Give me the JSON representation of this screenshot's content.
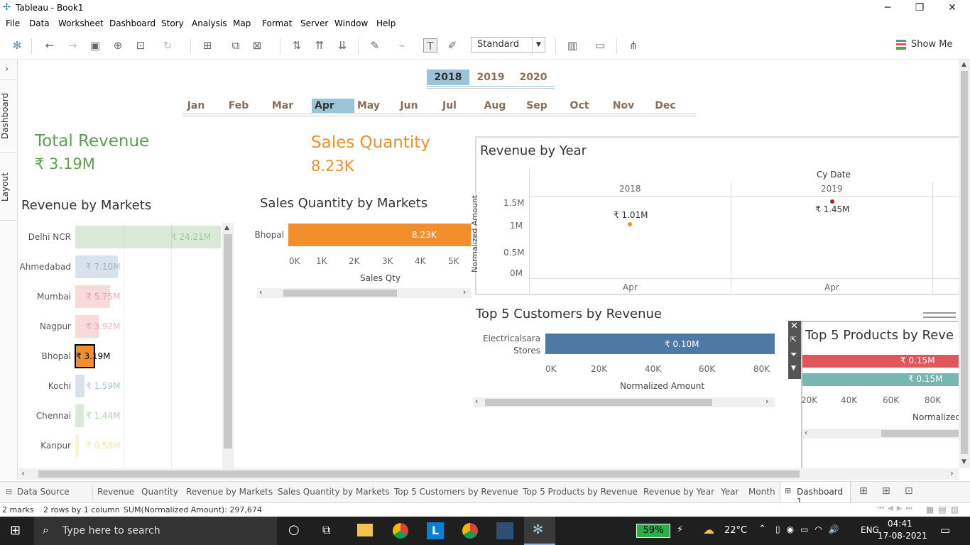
{
  "app": {
    "title": "Tableau - Book1"
  },
  "menu": [
    "File",
    "Data",
    "Worksheet",
    "Dashboard",
    "Story",
    "Analysis",
    "Map",
    "Format",
    "Server",
    "Window",
    "Help"
  ],
  "toolbar": {
    "mode": "Standard",
    "show_me": "Show Me"
  },
  "side_tabs": {
    "dashboard": "Dashboard",
    "layout": "Layout"
  },
  "years": [
    "2018",
    "2019",
    "2020"
  ],
  "selected_year": "2018",
  "months": [
    "Jan",
    "Feb",
    "Mar",
    "Apr",
    "May",
    "Jun",
    "Jul",
    "Aug",
    "Sep",
    "Oct",
    "Nov",
    "Dec"
  ],
  "selected_month": "Apr",
  "kpi": {
    "revenue_title": "Total Revenue",
    "revenue_value": "₹ 3.19M",
    "qty_title": "Sales Quantity",
    "qty_value": "8.23K"
  },
  "colors": {
    "green": "#59a14f",
    "orange": "#f28e2b",
    "blue": "#4e79a7",
    "red": "#e15759",
    "teal": "#76b7b2"
  },
  "revenue_by_markets": {
    "title": "Revenue by Markets",
    "rows": [
      {
        "market": "Delhi NCR",
        "label": "₹ 24.21M",
        "value": 24.21,
        "color": "#59a14f",
        "highlight": false
      },
      {
        "market": "Ahmedabad",
        "label": "₹ 7.10M",
        "value": 7.1,
        "color": "#4e79a7",
        "highlight": false
      },
      {
        "market": "Mumbai",
        "label": "₹ 5.75M",
        "value": 5.75,
        "color": "#e15759",
        "highlight": false
      },
      {
        "market": "Nagpur",
        "label": "₹ 3.92M",
        "value": 3.92,
        "color": "#e15759",
        "highlight": false
      },
      {
        "market": "Bhopal",
        "label": "₹ 3.19M",
        "value": 3.19,
        "color": "#f28e2b",
        "highlight": true
      },
      {
        "market": "Kochi",
        "label": "₹ 1.59M",
        "value": 1.59,
        "color": "#4e79a7",
        "highlight": false
      },
      {
        "market": "Chennai",
        "label": "₹ 1.44M",
        "value": 1.44,
        "color": "#59a14f",
        "highlight": false
      },
      {
        "market": "Kanpur",
        "label": "₹ 0.58M",
        "value": 0.58,
        "color": "#edc948",
        "highlight": false
      }
    ]
  },
  "sales_qty_by_markets": {
    "title": "Sales Quantity by Markets",
    "market": "Bhopal",
    "label": "8.23K",
    "ticks": [
      "0K",
      "1K",
      "2K",
      "3K",
      "4K",
      "5K"
    ],
    "axis": "Sales Qty"
  },
  "revenue_by_year": {
    "title": "Revenue by Year",
    "header": "Cy Date",
    "col1": "2018",
    "col2": "2019",
    "yaxis": "Normalized Amount",
    "yticks": [
      "1.5M",
      "1M",
      "0.5M",
      "0M"
    ],
    "lab1": "₹ 1.01M",
    "lab2": "₹ 1.45M",
    "month": "Apr"
  },
  "top_customers": {
    "title": "Top 5 Customers by Revenue",
    "customer_line1": "Electricalsara",
    "customer_line2": "Stores",
    "label": "₹ 0.10M",
    "ticks": [
      "0K",
      "20K",
      "40K",
      "60K",
      "80K"
    ],
    "axis": "Normalized Amount"
  },
  "top_products": {
    "title": "Top 5 Products by Reve",
    "lab1": "₹ 0.15M",
    "lab2": "₹ 0.15M",
    "ticks": [
      "20K",
      "40K",
      "60K",
      "80K"
    ],
    "axis": "Normalized"
  },
  "sheet_tabs": [
    "Data Source",
    "Revenue",
    "Quantity",
    "Revenue by Markets",
    "Sales Quantity by Markets",
    "Top 5 Customers by Revenue",
    "Top 5 Products by Revenue",
    "Revenue by Year",
    "Year",
    "Month",
    "Dashboard 1"
  ],
  "status": {
    "marks": "2 marks",
    "rows": "2 rows by 1 column",
    "sum": "SUM(Normalized Amount): 297,674"
  },
  "taskbar": {
    "search": "Type here to search",
    "battery": "59%",
    "temp": "22°C",
    "lang": "ENG",
    "time": "04:41",
    "date": "17-08-2021"
  }
}
